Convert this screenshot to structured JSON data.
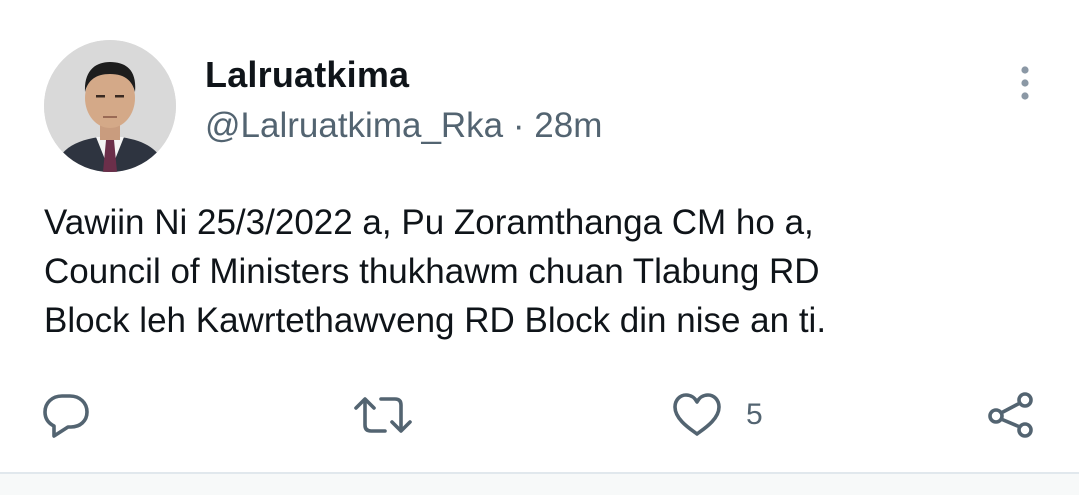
{
  "author": {
    "display_name": "Lalruatkima",
    "handle": "@Lalruatkima_Rka",
    "separator": "·",
    "time": "28m"
  },
  "tweet": {
    "lines": [
      "Vawiin Ni 25/3/2022 a, Pu Zoramthanga CM ho a,",
      "Council of Ministers thukhawm chuan Tlabung RD",
      "Block leh Kawrtethawveng RD Block din nise an ti."
    ]
  },
  "actions": {
    "reply_icon": "reply-icon",
    "retweet_icon": "retweet-icon",
    "like_icon": "heart-icon",
    "like_count": "5",
    "share_icon": "share-icon",
    "more_icon": "more-vertical-icon"
  },
  "colors": {
    "text_primary": "#0f1419",
    "text_secondary": "#536471",
    "icon": "#536471"
  }
}
